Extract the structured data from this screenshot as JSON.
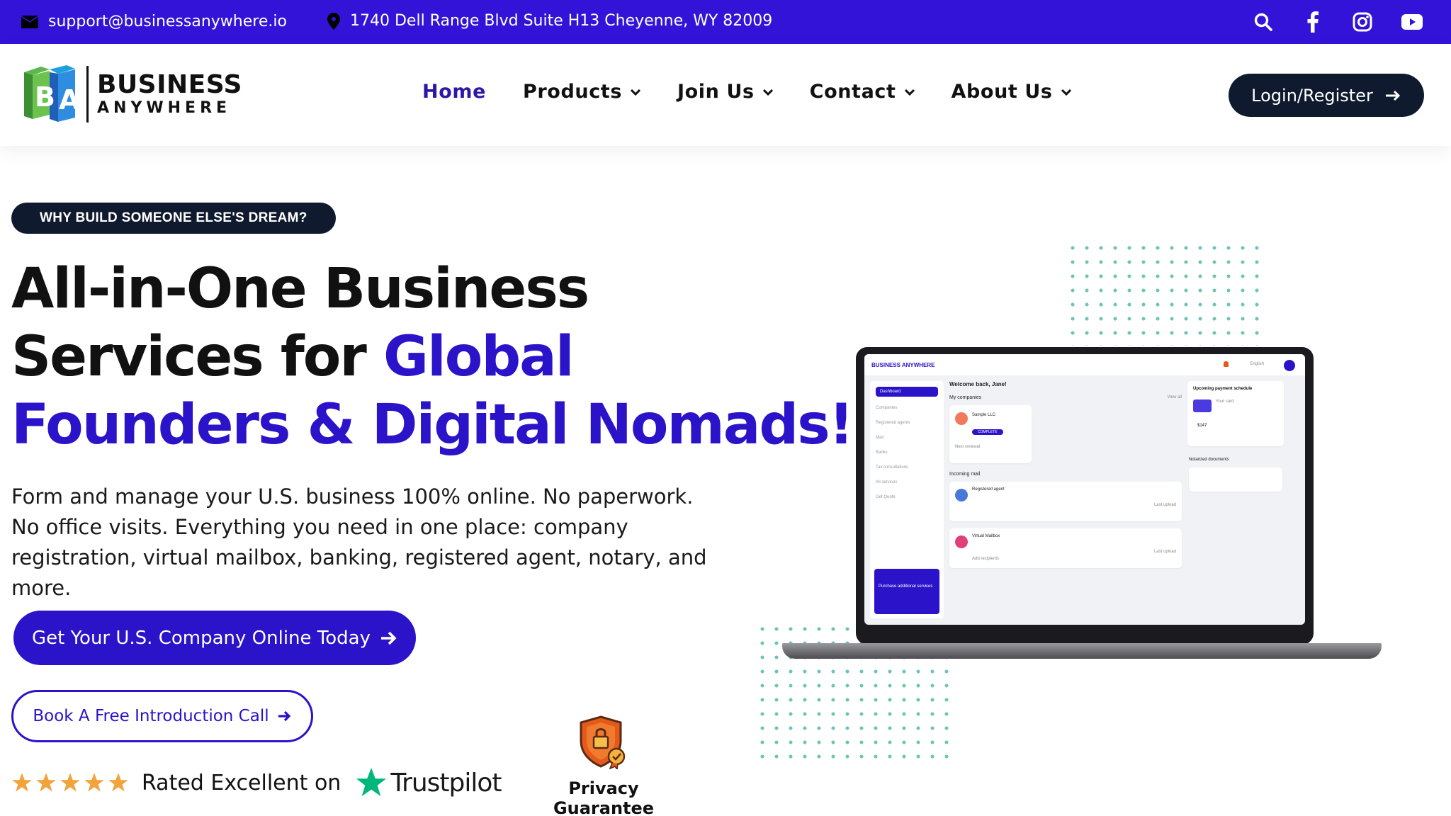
{
  "topbar": {
    "email": "support@businessanywhere.io",
    "address": "1740 Dell Range Blvd Suite H13 Cheyenne, WY 82009",
    "icons": [
      "search-icon",
      "facebook-icon",
      "instagram-icon",
      "youtube-icon"
    ],
    "background": "#3413d8"
  },
  "logo": {
    "line1": "BUSINESS",
    "line2": "ANYWHERE"
  },
  "nav": {
    "items": [
      {
        "label": "Home",
        "active": true,
        "dropdown": false
      },
      {
        "label": "Products",
        "active": false,
        "dropdown": true
      },
      {
        "label": "Join Us",
        "active": false,
        "dropdown": true
      },
      {
        "label": "Contact",
        "active": false,
        "dropdown": true
      },
      {
        "label": "About Us",
        "active": false,
        "dropdown": true
      }
    ],
    "login_label": "Login/Register"
  },
  "hero": {
    "badge": "WHY BUILD SOMEONE ELSE'S DREAM?",
    "headline_line1": "All-in-One Business",
    "headline_line2a": "Services for ",
    "headline_line2b": "Global",
    "headline_line3": "Founders & Digital Nomads!",
    "subtext": "Form and manage your U.S. business 100% online. No paperwork. No office visits. Everything you need in one place: company registration, virtual mailbox, banking, registered agent, notary, and more.",
    "cta_primary": "Get Your U.S. Company Online Today",
    "cta_secondary": "Book A Free Introduction Call",
    "rating_text": "Rated Excellent on",
    "rating_stars": 5,
    "trustpilot": "Trustpilot",
    "privacy_label": "Privacy Guarantee"
  },
  "dashboard": {
    "brand": "BUSINESS ANYWHERE",
    "language": "English",
    "welcome": "Welcome back, Jane!",
    "my_companies": "My companies",
    "view_all": "View all",
    "company_name": "Sample LLC",
    "complete": "COMPLETE",
    "next_renewal": "Next renewal",
    "incoming_mail": "Incoming mail",
    "registered_agent": "Registered agent",
    "virtual_mailbox": "Virtual Mailbox",
    "add_recipients": "Add recipients",
    "last_upload": "Last upload",
    "upcoming": "Upcoming payment schedule",
    "your_card": "Your card",
    "amount": "$147",
    "notarized": "Notarized documents",
    "sidebar": [
      "Dashboard",
      "Companies",
      "Registered agents",
      "Mail",
      "Banks",
      "Tax consultations",
      "All services",
      "Get Quote"
    ],
    "promo": "Purchase additional services"
  },
  "colors": {
    "accent": "#2b13c9",
    "dark": "#101a2e",
    "star": "#f2a33a",
    "trustpilot_green": "#00b67a"
  }
}
